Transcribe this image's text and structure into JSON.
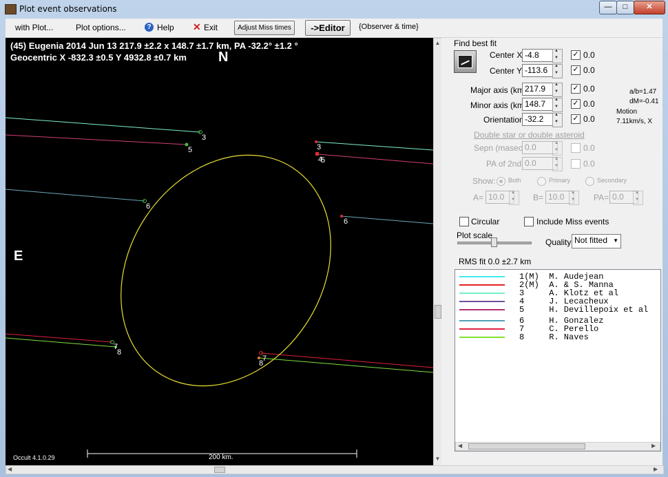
{
  "window": {
    "title": "Plot event observations",
    "btn_min": "—",
    "btn_max": "□",
    "btn_close": "✕"
  },
  "menu": {
    "with_plot": "with Plot...",
    "plot_options": "Plot options...",
    "help": "Help",
    "exit": "Exit",
    "adjust_miss": "Adjust Miss times",
    "editor": "->Editor",
    "observer_time": "{Observer & time}"
  },
  "plot": {
    "title_line1": "(45) Eugenia  2014 Jun 13   217.9 ±2.2 x 148.7 ±1.7 km, PA -32.2° ±1.2 °",
    "title_line2": "Geocentric X  -832.3 ±0.5  Y 4932.8 ±0.7 km",
    "north_label": "N",
    "east_label": "E",
    "version": "Occult 4.1.0.29",
    "scale_label": "200 km.",
    "chord_labels": {
      "c3a": "3",
      "c5a": "5",
      "c3b": "3",
      "c4b": "4",
      "c5b": "5",
      "c6a": "6",
      "c6b": "6",
      "c7a": "7",
      "c8a": "8",
      "c7b": "7",
      "c8b": "8"
    },
    "colors": {
      "ellipse": "#e8e030",
      "chord3": "#7ff0d0",
      "chord5": "#d0407a",
      "chord6": "#6aa8b8",
      "chord7": "#e02040",
      "chord8": "#80e040"
    }
  },
  "panel": {
    "find_best_fit": "Find best fit",
    "center_x_label": "Center X",
    "center_x_value": "-4.8",
    "center_x_res": "0.0",
    "center_y_label": "Center Y",
    "center_y_value": "-113.6",
    "center_y_res": "0.0",
    "major_label": "Major axis (km)",
    "major_value": "217.9",
    "major_res": "0.0",
    "minor_label": "Minor axis (km)",
    "minor_value": "148.7",
    "minor_res": "0.0",
    "orient_label": "Orientation",
    "orient_value": "-32.2",
    "orient_res": "0.0",
    "ab_ratio": "a/b=1.47",
    "dm": "dM=-0.41",
    "motion_label": "Motion",
    "motion_value": "7.11km/s, X",
    "double_star": "Double star  or  double asteroid",
    "sepn_label": "Sepn (masec)",
    "sepn_value": "0.0",
    "sepn_res": "0.0",
    "pa2_label": "PA of 2nd",
    "pa2_value": "0.0",
    "pa2_res": "0.0",
    "show_label": "Show:",
    "show_both": "Both",
    "show_primary": "Primary",
    "show_secondary": "Secondary",
    "a_label": "A=",
    "a_value": "10.0",
    "b_label": "B=",
    "b_value": "10.0",
    "pa_label": "PA=",
    "pa_value": "0.0",
    "circular": "Circular",
    "include_miss": "Include Miss events",
    "plot_scale": "Plot scale",
    "quality_label": "Quality",
    "quality_value": "Not fitted",
    "rms_fit": "RMS fit  0.0 ±2.7 km"
  },
  "legend": [
    {
      "text": "1(M)  M. Audejean",
      "color": "#40e8f0"
    },
    {
      "text": "2(M)  A. & S. Manna",
      "color": "#e02020"
    },
    {
      "text": "3     A. Klotz et al",
      "color": "#70f0c8"
    },
    {
      "text": "4     J. Lecacheux",
      "color": "#7050a0"
    },
    {
      "text": "5     H. Devillepoix et al",
      "color": "#b03070"
    },
    {
      "text": "6     H. Gonzalez",
      "color": "#50a0b8"
    },
    {
      "text": "7     C. Perello",
      "color": "#e02040"
    },
    {
      "text": "8     R. Naves",
      "color": "#80e030"
    }
  ]
}
